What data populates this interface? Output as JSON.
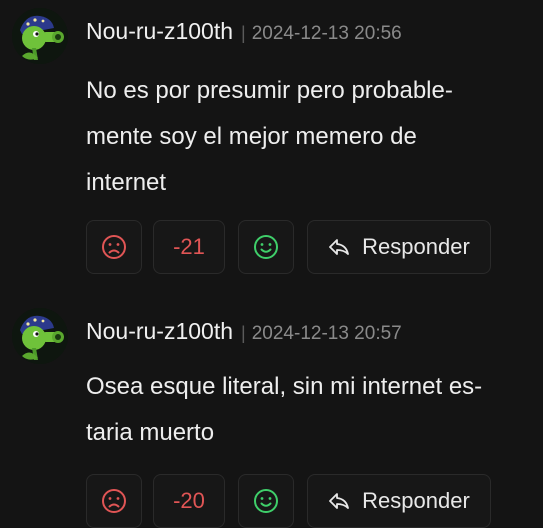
{
  "comments": [
    {
      "username": "Nou-ru-z100th",
      "separator": "|",
      "timestamp": "2024-12-13 20:56",
      "lines": [
        "No es por presumir pero probable-",
        "mente soy el mejor memero de",
        "internet"
      ],
      "score": "-21",
      "reply_label": "Responder"
    },
    {
      "username": "Nou-ru-z100th",
      "separator": "|",
      "timestamp": "2024-12-13 20:57",
      "lines": [
        "Osea esque literal, sin mi internet es-",
        "taria muerto"
      ],
      "score": "-20",
      "reply_label": "Responder"
    }
  ],
  "icons": {
    "downvote": "sad-face-icon",
    "upvote": "smile-face-icon",
    "reply": "reply-arrow-icon",
    "avatar": "peashooter-avatar"
  },
  "colors": {
    "background": "#141414",
    "downvote": "#e05555",
    "upvote": "#3fcf6a",
    "score": "#e05555"
  }
}
